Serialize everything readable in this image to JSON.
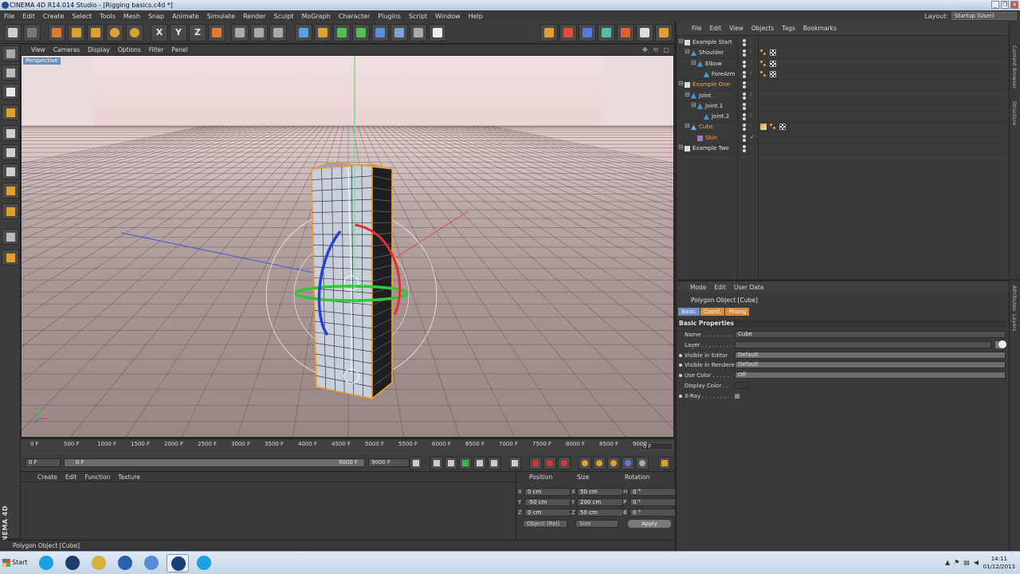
{
  "window": {
    "title": "CINEMA 4D R14.014 Studio - [Rigging basics.c4d *]",
    "controls": [
      "_",
      "❐",
      "✕"
    ]
  },
  "menu": [
    "File",
    "Edit",
    "Create",
    "Select",
    "Tools",
    "Mesh",
    "Snap",
    "Animate",
    "Simulate",
    "Render",
    "Sculpt",
    "MoGraph",
    "Character",
    "Plugins",
    "Script",
    "Window",
    "Help"
  ],
  "layout": {
    "label": "Layout:",
    "value": "Startup (User)"
  },
  "toolbar": {
    "axis_x": "X",
    "axis_y": "Y",
    "axis_z": "Z"
  },
  "viewport": {
    "menu": [
      "View",
      "Cameras",
      "Display",
      "Options",
      "Filter",
      "Panel"
    ],
    "label": "Perspective"
  },
  "timeline": {
    "ticks": [
      "0 F",
      "500 F",
      "1000 F",
      "1500 F",
      "2000 F",
      "2500 F",
      "3000 F",
      "3500 F",
      "4000 F",
      "4500 F",
      "5000 F",
      "5500 F",
      "6000 F",
      "6500 F",
      "7000 F",
      "7500 F",
      "8000 F",
      "8500 F",
      "9000"
    ],
    "current_frame": "0 F",
    "start_field": "0 F",
    "range_start": "0 F",
    "range_end": "9000 F",
    "end_field": "9000 F"
  },
  "material_manager": {
    "menu": [
      "Create",
      "Edit",
      "Function",
      "Texture"
    ]
  },
  "coordinates": {
    "headers": {
      "position": "Position",
      "size": "Size",
      "rotation": "Rotation"
    },
    "rows": [
      {
        "axis": "X",
        "pos": "0 cm",
        "size_axis": "X",
        "size": "50 cm",
        "rot_axis": "H",
        "rot": "0 °"
      },
      {
        "axis": "Y",
        "pos": "-50 cm",
        "size_axis": "Y",
        "size": "200 cm",
        "rot_axis": "P",
        "rot": "0 °"
      },
      {
        "axis": "Z",
        "pos": "0 cm",
        "size_axis": "Z",
        "size": "50 cm",
        "rot_axis": "B",
        "rot": "0 °"
      }
    ],
    "mode_select": "Object (Rel)",
    "size_select": "Size",
    "apply": "Apply"
  },
  "status": {
    "text": "Polygon Object [Cube]"
  },
  "object_manager": {
    "menu": [
      "File",
      "Edit",
      "View",
      "Objects",
      "Tags",
      "Bookmarks"
    ],
    "rows": [
      {
        "name": "Example Start",
        "indent": 0,
        "type": "null",
        "tags": []
      },
      {
        "name": "Shoulder",
        "indent": 1,
        "type": "joint",
        "tags": [
          "joint",
          "checker"
        ]
      },
      {
        "name": "Elbow",
        "indent": 2,
        "type": "joint",
        "tags": [
          "joint",
          "checker"
        ]
      },
      {
        "name": "ForeArm",
        "indent": 3,
        "type": "joint",
        "tags": [
          "joint",
          "checker"
        ]
      },
      {
        "name": "Example One",
        "indent": 0,
        "type": "null",
        "tags": [],
        "highlight": true
      },
      {
        "name": "Joint",
        "indent": 1,
        "type": "joint",
        "tags": []
      },
      {
        "name": "Joint.1",
        "indent": 2,
        "type": "joint",
        "tags": []
      },
      {
        "name": "Joint.2",
        "indent": 3,
        "type": "joint",
        "tags": []
      },
      {
        "name": "Cube",
        "indent": 1,
        "type": "poly",
        "tags": [
          "weight",
          "joint",
          "checker"
        ],
        "highlight": true
      },
      {
        "name": "Skin",
        "indent": 2,
        "type": "skin",
        "tags": [
          "check"
        ],
        "highlight": true
      },
      {
        "name": "Example Two",
        "indent": 0,
        "type": "null",
        "tags": []
      }
    ]
  },
  "side_tabs": [
    "Content Browser",
    "Structure"
  ],
  "side_tabs2": [
    "Attributes",
    "Layers"
  ],
  "attributes": {
    "menu": [
      "Mode",
      "Edit",
      "User Data"
    ],
    "title": "Polygon Object [Cube]",
    "tabs": [
      "Basic",
      "Coord.",
      "Phong"
    ],
    "section": "Basic Properties",
    "fields": [
      {
        "label": "Name . . . . . . . . . . .",
        "value": "Cube",
        "kind": "text",
        "bullet": false
      },
      {
        "label": "Layer . . . . . . . . . . .",
        "value": "",
        "kind": "text",
        "bullet": false
      },
      {
        "label": "Visible in Editor",
        "value": "Default",
        "kind": "dd",
        "bullet": true
      },
      {
        "label": "Visible in Renderer",
        "value": "Default",
        "kind": "dd",
        "bullet": true
      },
      {
        "label": "Use Color . . . . .",
        "value": "Off",
        "kind": "dd",
        "bullet": true
      },
      {
        "label": "Display Color . .",
        "value": "",
        "kind": "swatch",
        "bullet": false
      },
      {
        "label": "X-Ray . . . . . . . .",
        "value": "",
        "kind": "check",
        "bullet": true
      }
    ]
  },
  "taskbar": {
    "start": "Start",
    "time": "14:11",
    "date": "01/12/2013"
  }
}
